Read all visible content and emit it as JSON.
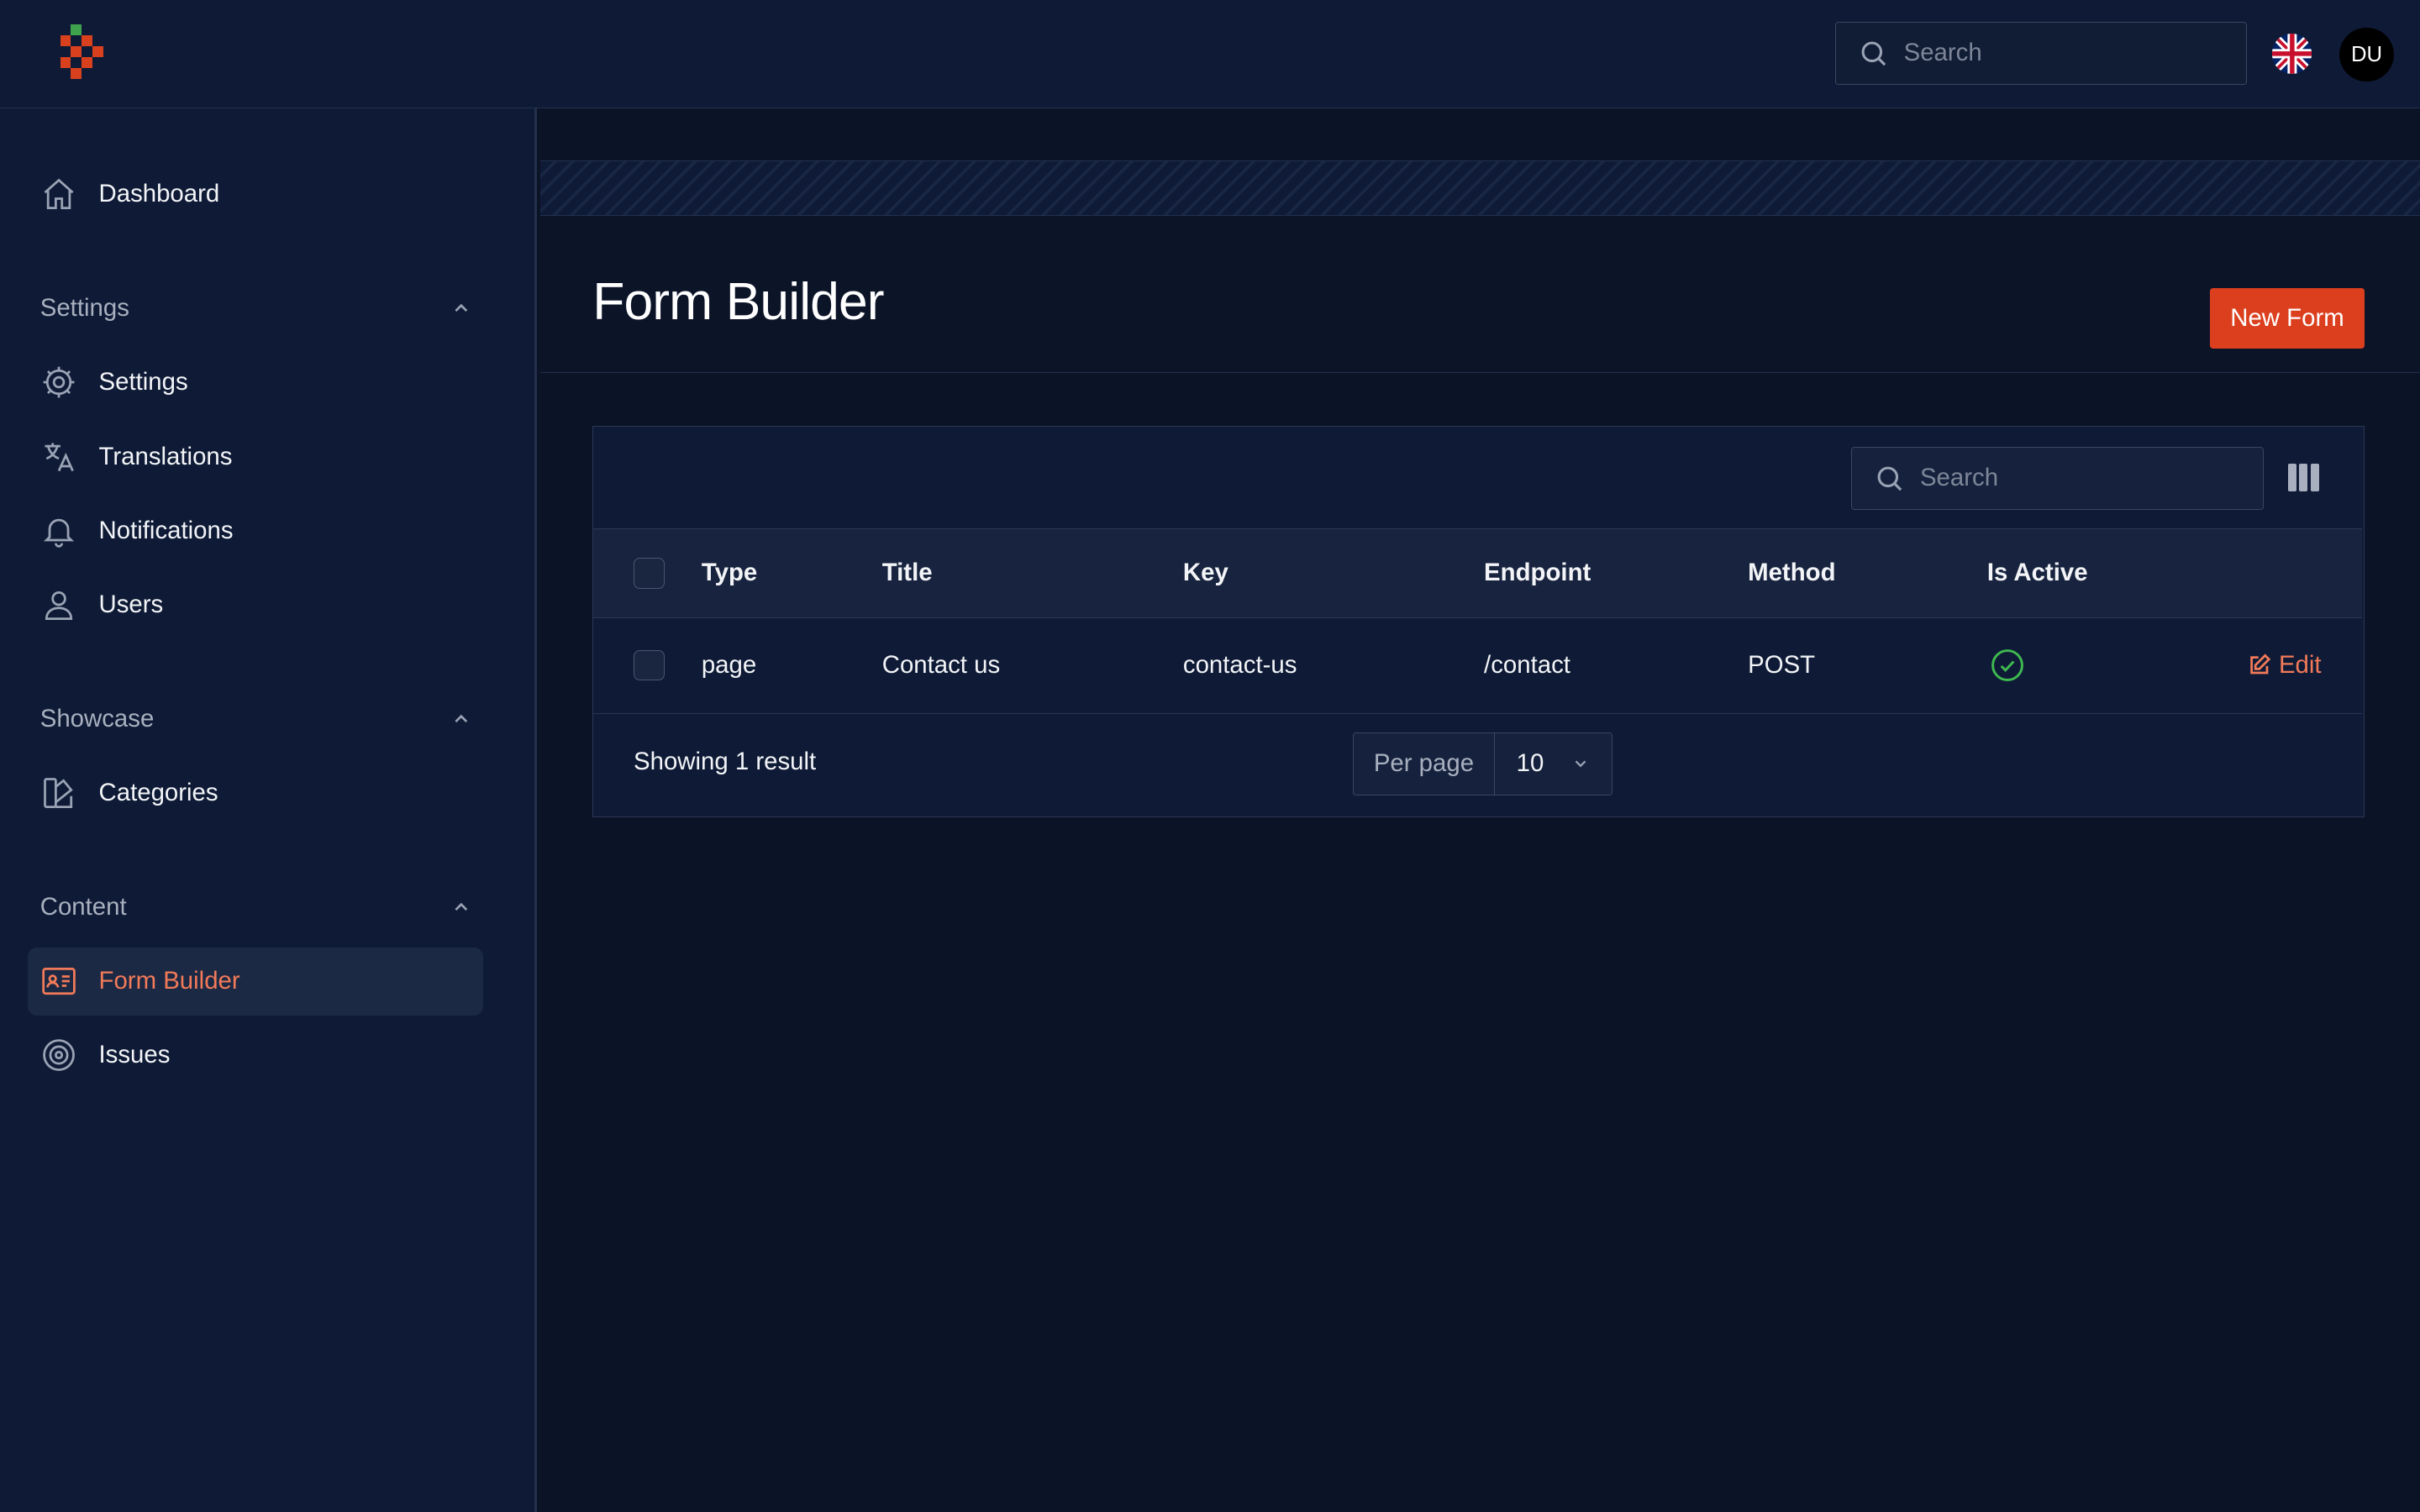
{
  "header": {
    "search_placeholder": "Search",
    "avatar_initials": "DU",
    "language": "English (UK)"
  },
  "sidebar": {
    "dashboard": "Dashboard",
    "groups": {
      "settings": "Settings",
      "showcase": "Showcase",
      "content": "Content"
    },
    "items": {
      "settings": "Settings",
      "translations": "Translations",
      "notifications": "Notifications",
      "users": "Users",
      "categories": "Categories",
      "form_builder": "Form Builder",
      "issues": "Issues"
    },
    "active_item": "Form Builder"
  },
  "page": {
    "title": "Form Builder",
    "new_button": "New Form"
  },
  "table": {
    "search_placeholder": "Search",
    "columns": [
      "Type",
      "Title",
      "Key",
      "Endpoint",
      "Method",
      "Is Active"
    ],
    "rows": [
      {
        "type": "page",
        "title": "Contact us",
        "key": "contact-us",
        "endpoint": "/contact",
        "method": "POST",
        "is_active": true,
        "action": "Edit"
      }
    ],
    "footer": {
      "showing": "Showing 1 result",
      "per_page_label": "Per page",
      "per_page_value": "10"
    }
  },
  "colors": {
    "accent": "#db3f1e",
    "accent_text": "#f27a59",
    "active_check": "#3fb950",
    "background": "#0b1326",
    "panel": "#0f1b36"
  }
}
